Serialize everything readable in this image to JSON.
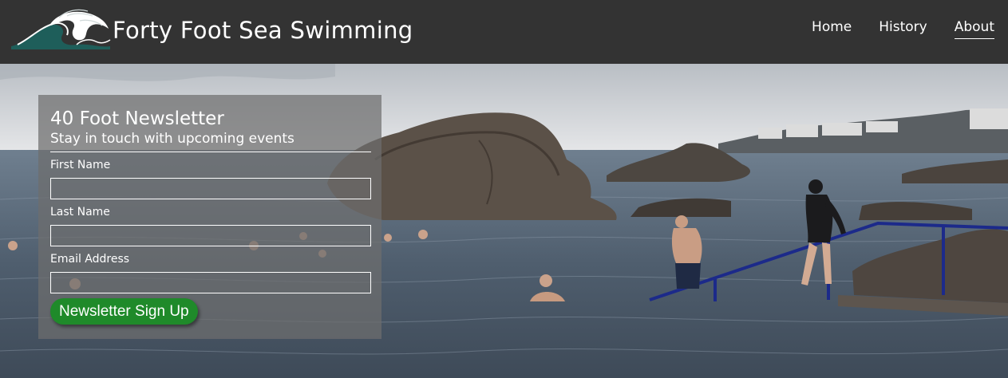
{
  "site": {
    "brand": "Forty Foot Sea Swimming",
    "logo_icon": "wave-icon"
  },
  "nav": {
    "items": [
      {
        "label": "Home",
        "active": false
      },
      {
        "label": "History",
        "active": false
      },
      {
        "label": "About",
        "active": true
      }
    ]
  },
  "newsletter": {
    "title": "40 Foot Newsletter",
    "subtitle": "Stay in touch with upcoming events",
    "fields": [
      {
        "label": "First Name",
        "value": "",
        "placeholder": ""
      },
      {
        "label": "Last Name",
        "value": "",
        "placeholder": ""
      },
      {
        "label": "Email Address",
        "value": "",
        "placeholder": ""
      }
    ],
    "button_label": "Newsletter Sign Up"
  },
  "colors": {
    "header_bg": "#333333",
    "button_bg": "#1f8a2a",
    "panel_bg": "rgba(110,110,110,0.72)"
  }
}
